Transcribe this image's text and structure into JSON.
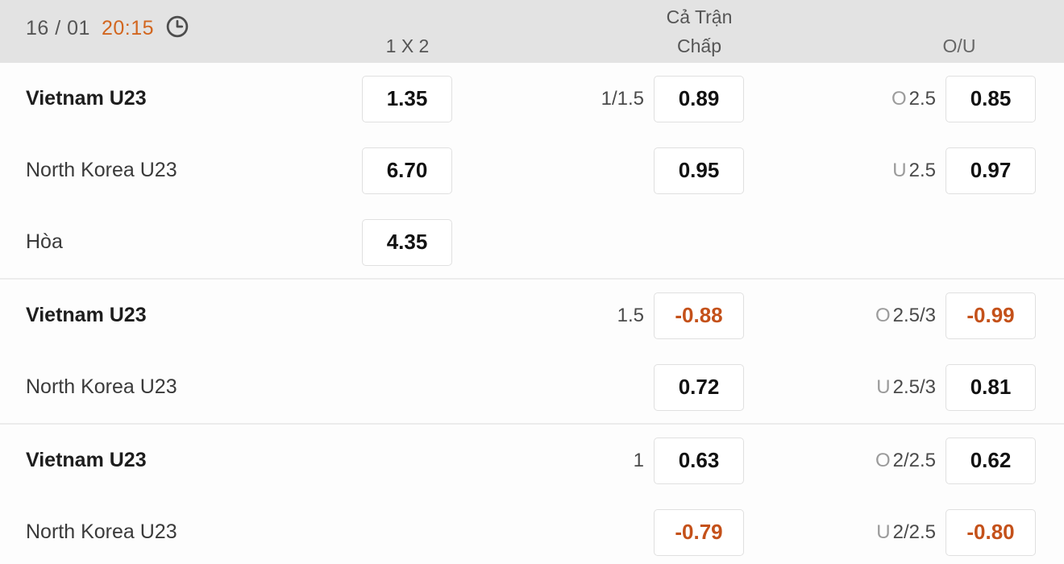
{
  "header": {
    "date": "16 / 01",
    "time": "20:15",
    "clock_icon": "clock-icon",
    "col_1x2": "1 X 2",
    "group_caption": "Cả Trận",
    "col_handicap": "Chấp",
    "col_over_under": "O/U"
  },
  "colors": {
    "accent_time": "#d2661f",
    "negative_odds": "#c4511a",
    "header_bg": "#e3e3e3",
    "box_border": "#e0e0e0",
    "muted_label": "#9b9b9b"
  },
  "groups": [
    {
      "rows": [
        {
          "team": "Vietnam U23",
          "bold": true,
          "odds_1x2": "1.35",
          "handicap_label": "1/1.5",
          "handicap_odds": "0.89",
          "handicap_negative": false,
          "ou_prefix": "O",
          "ou_label": "2.5",
          "ou_odds": "0.85",
          "ou_negative": false
        },
        {
          "team": "North Korea U23",
          "bold": false,
          "odds_1x2": "6.70",
          "handicap_label": "",
          "handicap_odds": "0.95",
          "handicap_negative": false,
          "ou_prefix": "U",
          "ou_label": "2.5",
          "ou_odds": "0.97",
          "ou_negative": false
        },
        {
          "team": "Hòa",
          "bold": false,
          "odds_1x2": "4.35",
          "handicap_label": "",
          "handicap_odds": "",
          "handicap_negative": false,
          "ou_prefix": "",
          "ou_label": "",
          "ou_odds": "",
          "ou_negative": false
        }
      ]
    },
    {
      "rows": [
        {
          "team": "Vietnam U23",
          "bold": true,
          "odds_1x2": "",
          "handicap_label": "1.5",
          "handicap_odds": "-0.88",
          "handicap_negative": true,
          "ou_prefix": "O",
          "ou_label": "2.5/3",
          "ou_odds": "-0.99",
          "ou_negative": true
        },
        {
          "team": "North Korea U23",
          "bold": false,
          "odds_1x2": "",
          "handicap_label": "",
          "handicap_odds": "0.72",
          "handicap_negative": false,
          "ou_prefix": "U",
          "ou_label": "2.5/3",
          "ou_odds": "0.81",
          "ou_negative": false
        }
      ]
    },
    {
      "rows": [
        {
          "team": "Vietnam U23",
          "bold": true,
          "odds_1x2": "",
          "handicap_label": "1",
          "handicap_odds": "0.63",
          "handicap_negative": false,
          "ou_prefix": "O",
          "ou_label": "2/2.5",
          "ou_odds": "0.62",
          "ou_negative": false
        },
        {
          "team": "North Korea U23",
          "bold": false,
          "odds_1x2": "",
          "handicap_label": "",
          "handicap_odds": "-0.79",
          "handicap_negative": true,
          "ou_prefix": "U",
          "ou_label": "2/2.5",
          "ou_odds": "-0.80",
          "ou_negative": true
        }
      ]
    }
  ]
}
